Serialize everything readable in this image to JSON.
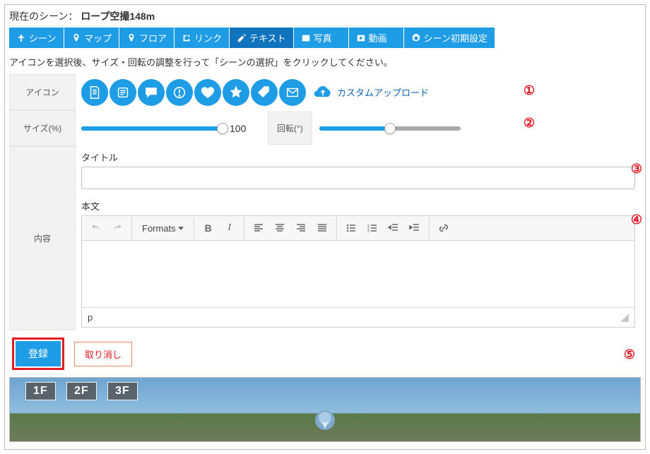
{
  "scene": {
    "label": "現在のシーン：",
    "name": "ロープ空撮148m"
  },
  "tabs": [
    {
      "label": "シーン"
    },
    {
      "label": "マップ"
    },
    {
      "label": "フロア"
    },
    {
      "label": "リンク"
    },
    {
      "label": "テキスト"
    },
    {
      "label": "写真"
    },
    {
      "label": "動画"
    },
    {
      "label": "シーン初期設定"
    }
  ],
  "note": "アイコンを選択後、サイズ・回転の調整を行って「シーンの選択」をクリックしてください。",
  "labels": {
    "icon": "アイコン",
    "size": "サイズ(%)",
    "rotation": "回転(°)",
    "content": "内容",
    "title": "タイトル",
    "body": "本文"
  },
  "upload": {
    "label": "カスタムアップロード"
  },
  "size": {
    "value": "100",
    "percent": 100
  },
  "rotation": {
    "percent": 50
  },
  "editor": {
    "formats": "Formats",
    "status": "p"
  },
  "actions": {
    "submit": "登録",
    "cancel": "取り消し"
  },
  "floors": [
    "1F",
    "2F",
    "3F"
  ],
  "annotations": {
    "a1": "①",
    "a2": "②",
    "a3": "③",
    "a4": "④",
    "a5": "⑤"
  }
}
